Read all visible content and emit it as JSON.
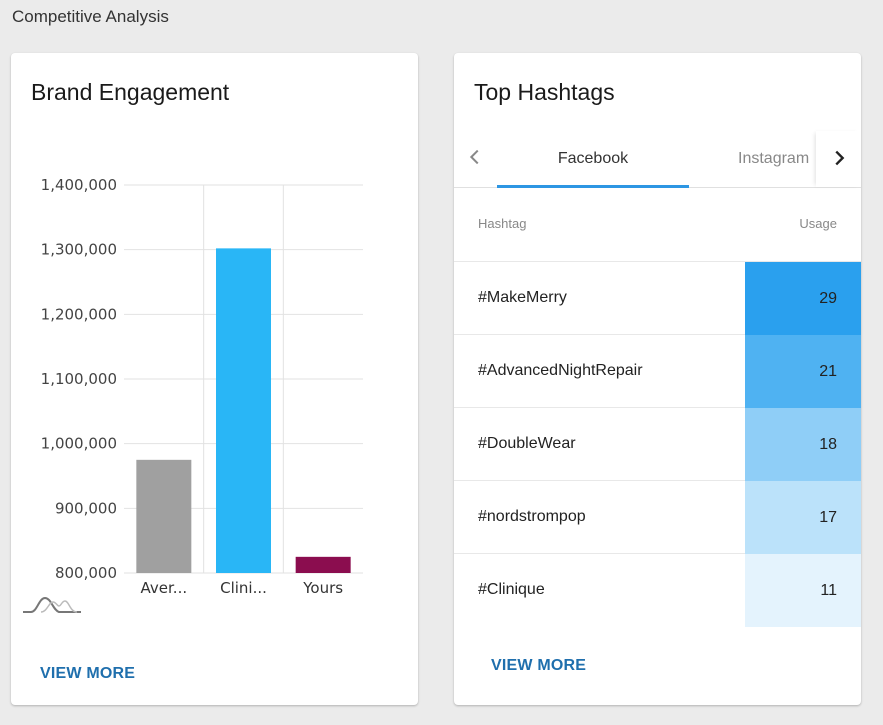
{
  "page": {
    "title": "Competitive Analysis"
  },
  "engagement": {
    "title": "Brand Engagement",
    "view_more": "VIEW MORE",
    "icon": "sparkline-icon"
  },
  "chart_data": {
    "type": "bar",
    "title": "Brand Engagement",
    "categories": [
      "Aver...",
      "Clini...",
      "Yours"
    ],
    "values": [
      975000,
      1302000,
      825000
    ],
    "colors": [
      "#a0a0a0",
      "#29b6f6",
      "#8b0d4f"
    ],
    "ylim": [
      800000,
      1400000
    ],
    "yticks": [
      800000,
      900000,
      1000000,
      1100000,
      1200000,
      1300000,
      1400000
    ],
    "ytick_labels": [
      "800,000",
      "900,000",
      "1,000,000",
      "1,100,000",
      "1,200,000",
      "1,300,000",
      "1,400,000"
    ],
    "xlabel": "",
    "ylabel": "",
    "grid": true,
    "legend": "none"
  },
  "hashtags": {
    "title": "Top Hashtags",
    "tabs": [
      {
        "label": "Facebook",
        "active": true
      },
      {
        "label": "Instagram",
        "active": false
      }
    ],
    "columns": {
      "hashtag": "Hashtag",
      "usage": "Usage"
    },
    "rows": [
      {
        "tag": "#MakeMerry",
        "usage": "29",
        "color": "#2aa0ee"
      },
      {
        "tag": "#AdvancedNightRepair",
        "usage": "21",
        "color": "#4fb2f2"
      },
      {
        "tag": "#DoubleWear",
        "usage": "18",
        "color": "#8fcef7"
      },
      {
        "tag": "#nordstrompop",
        "usage": "17",
        "color": "#bbe2fa"
      },
      {
        "tag": "#Clinique",
        "usage": "11",
        "color": "#e4f3fd"
      }
    ],
    "view_more": "VIEW MORE"
  }
}
